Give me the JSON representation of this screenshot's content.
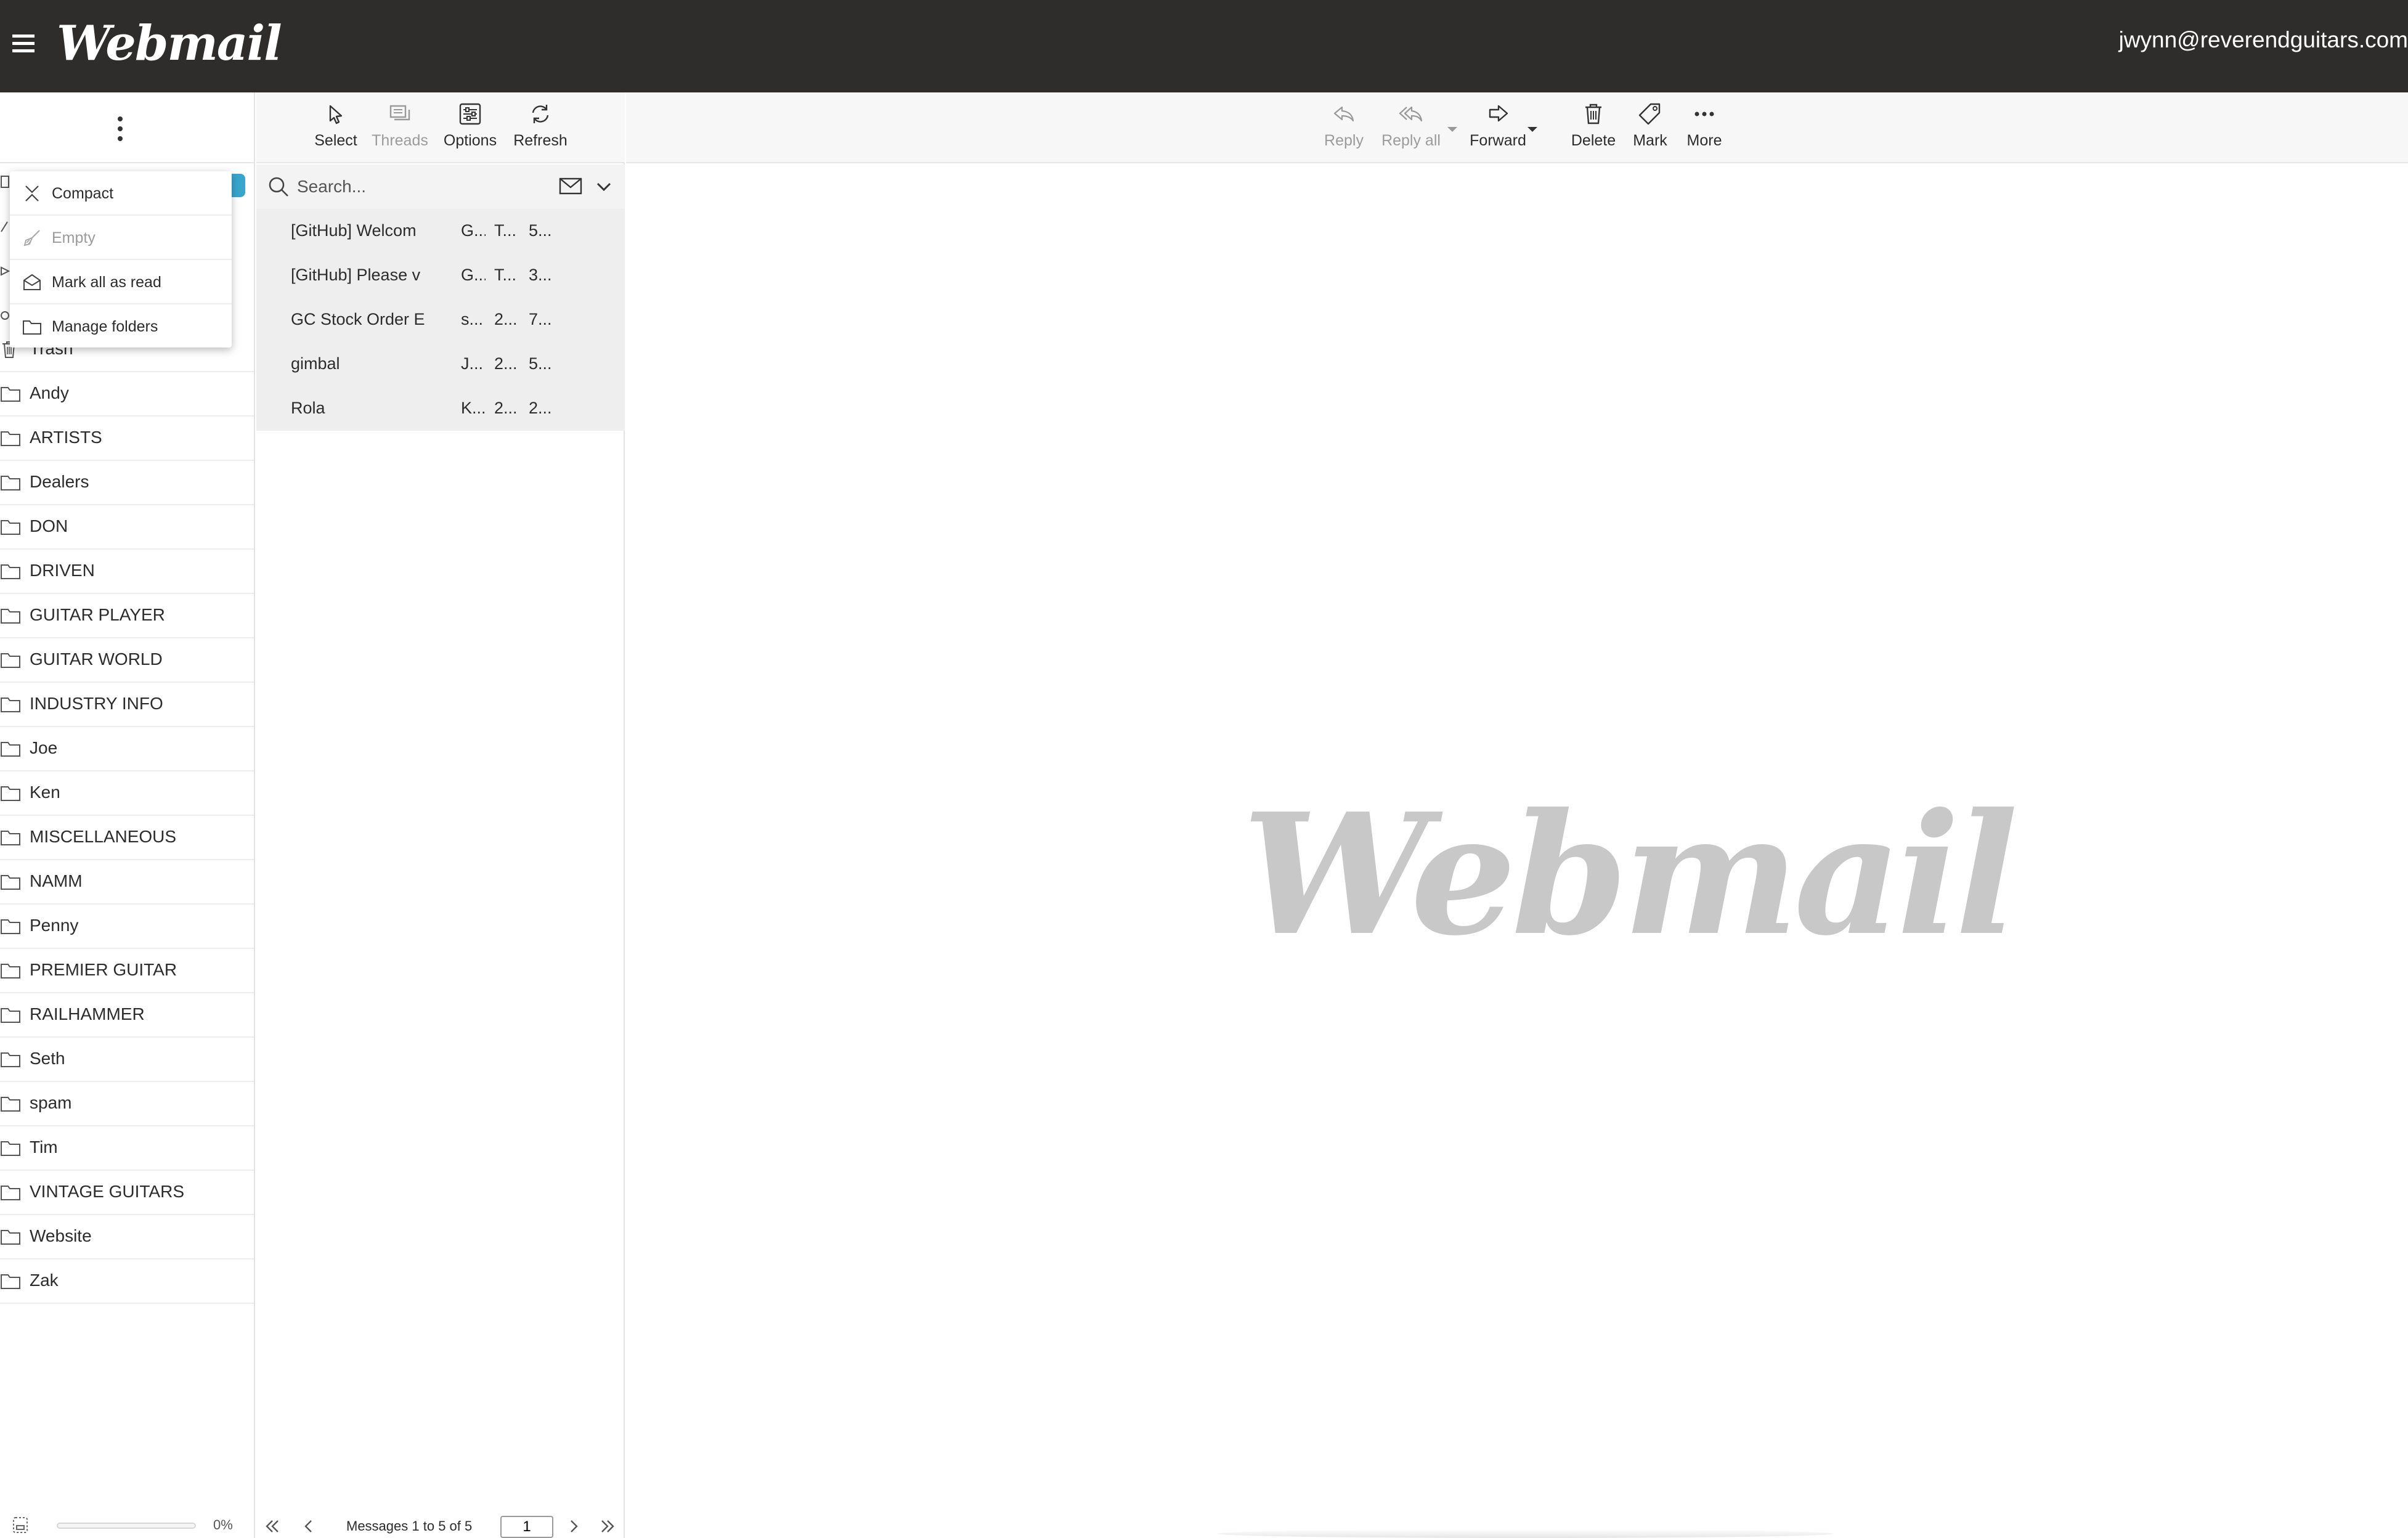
{
  "header": {
    "logo": "Webmail",
    "user_email": "jwynn@reverendguitars.com"
  },
  "folder_menu": {
    "items": [
      {
        "label": "Compact",
        "icon": "compact-icon",
        "enabled": true
      },
      {
        "label": "Empty",
        "icon": "broom-icon",
        "enabled": false
      },
      {
        "label": "Mark all as read",
        "icon": "envelope-open-icon",
        "enabled": true
      },
      {
        "label": "Manage folders",
        "icon": "folder-icon",
        "enabled": true
      }
    ]
  },
  "folders": [
    {
      "label": "Trash",
      "icon": "trash-icon"
    },
    {
      "label": "Andy",
      "icon": "folder-icon"
    },
    {
      "label": "ARTISTS",
      "icon": "folder-icon"
    },
    {
      "label": "Dealers",
      "icon": "folder-icon"
    },
    {
      "label": "DON",
      "icon": "folder-icon"
    },
    {
      "label": "DRIVEN",
      "icon": "folder-icon"
    },
    {
      "label": "GUITAR PLAYER",
      "icon": "folder-icon"
    },
    {
      "label": "GUITAR WORLD",
      "icon": "folder-icon"
    },
    {
      "label": "INDUSTRY INFO",
      "icon": "folder-icon"
    },
    {
      "label": "Joe",
      "icon": "folder-icon"
    },
    {
      "label": "Ken",
      "icon": "folder-icon"
    },
    {
      "label": "MISCELLANEOUS",
      "icon": "folder-icon"
    },
    {
      "label": "NAMM",
      "icon": "folder-icon"
    },
    {
      "label": "Penny",
      "icon": "folder-icon"
    },
    {
      "label": "PREMIER GUITAR",
      "icon": "folder-icon"
    },
    {
      "label": "RAILHAMMER",
      "icon": "folder-icon"
    },
    {
      "label": "Seth",
      "icon": "folder-icon"
    },
    {
      "label": "spam",
      "icon": "folder-icon"
    },
    {
      "label": "Tim",
      "icon": "folder-icon"
    },
    {
      "label": "VINTAGE GUITARS",
      "icon": "folder-icon"
    },
    {
      "label": "Website",
      "icon": "folder-icon"
    },
    {
      "label": "Zak",
      "icon": "folder-icon"
    }
  ],
  "quota": {
    "percent_label": "0%",
    "percent": 0
  },
  "list_toolbar": {
    "select": "Select",
    "threads": "Threads",
    "options": "Options",
    "refresh": "Refresh"
  },
  "search": {
    "placeholder": "Search..."
  },
  "messages": [
    {
      "subject": "[GitHub] Welcom",
      "from": "G...",
      "date": "T...",
      "size": "5..."
    },
    {
      "subject": "[GitHub] Please v",
      "from": "G...",
      "date": "T...",
      "size": "3..."
    },
    {
      "subject": "GC Stock Order E",
      "from": "s...",
      "date": "2...",
      "size": "7..."
    },
    {
      "subject": "gimbal",
      "from": "J...",
      "date": "2...",
      "size": "5..."
    },
    {
      "subject": "Rola",
      "from": "K...",
      "date": "2...",
      "size": "2..."
    }
  ],
  "list_footer": {
    "count": "Messages 1 to 5 of 5",
    "page": "1"
  },
  "content_toolbar": {
    "reply": "Reply",
    "reply_all": "Reply all",
    "forward": "Forward",
    "delete": "Delete",
    "mark": "Mark",
    "more": "More"
  },
  "watermark": "Webmail",
  "colors": {
    "header_bg": "#2e2d2b",
    "accent": "#37a6cd",
    "watermark": "#c8c8c8"
  }
}
